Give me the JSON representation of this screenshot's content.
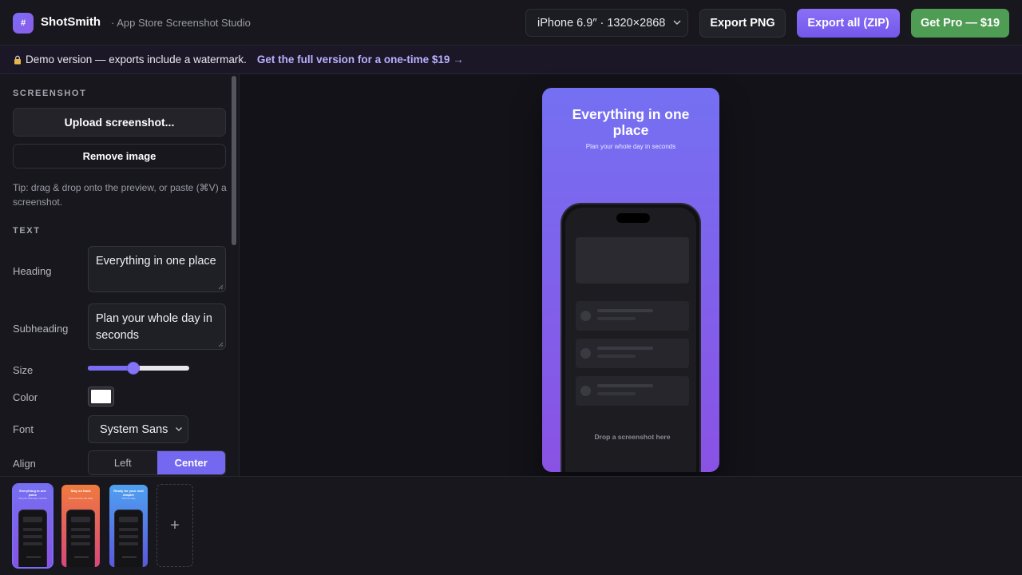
{
  "header": {
    "logo_glyph": "#",
    "app_name": "ShotSmith",
    "tagline": "· App Store Screenshot Studio",
    "device_select": "iPhone 6.9″ · 1320×2868",
    "export_png": "Export PNG",
    "export_all": "Export all (ZIP)",
    "get_pro": "Get Pro — $19"
  },
  "banner": {
    "icon": "lock-icon",
    "note": "Demo version — exports include a watermark.",
    "cta": "Get the full version for a one-time $19 →"
  },
  "sidebar": {
    "screenshot_section": "SCREENSHOT",
    "upload_button": "Upload screenshot...",
    "remove_button": "Remove image",
    "tip": "Tip: drag & drop onto the preview, or paste (⌘V) a screenshot.",
    "text_section": "TEXT",
    "heading_label": "Heading",
    "heading_value": "Everything in one place",
    "subheading_label": "Subheading",
    "subheading_value": "Plan your whole day in seconds",
    "size_label": "Size",
    "size_value": "104",
    "size_fraction": 0.45,
    "color_label": "Color",
    "color_value": "#ffffff",
    "font_label": "Font",
    "font_value": "System Sans",
    "align_label": "Align",
    "align_options": [
      "Left",
      "Center"
    ],
    "align_selected": "Center"
  },
  "preview": {
    "heading": "Everything in one place",
    "subheading": "Plan your whole day in seconds",
    "drop_hint": "Drop a screenshot here",
    "gradient": [
      "#7570f2",
      "#8a52e4"
    ]
  },
  "filmstrip": {
    "thumbnails": [
      {
        "heading": "Everything in one place",
        "subheading": "Plan your whole day in seconds",
        "colors": [
          "#7570f2",
          "#8a52e4"
        ],
        "selected": true
      },
      {
        "heading": "Stay on track",
        "subheading": "Smart reminders that adapt",
        "colors": [
          "#f07a3e",
          "#d9477a"
        ],
        "selected": false
      },
      {
        "heading": "Ready for your next chapter",
        "subheading": "Start free today",
        "colors": [
          "#4ea0f0",
          "#5a58e0"
        ],
        "selected": false
      }
    ],
    "add_label": "+"
  },
  "colors": {
    "accent": "#7a6cf4",
    "pro_green": "#4f9c54",
    "background": "#13131a"
  }
}
